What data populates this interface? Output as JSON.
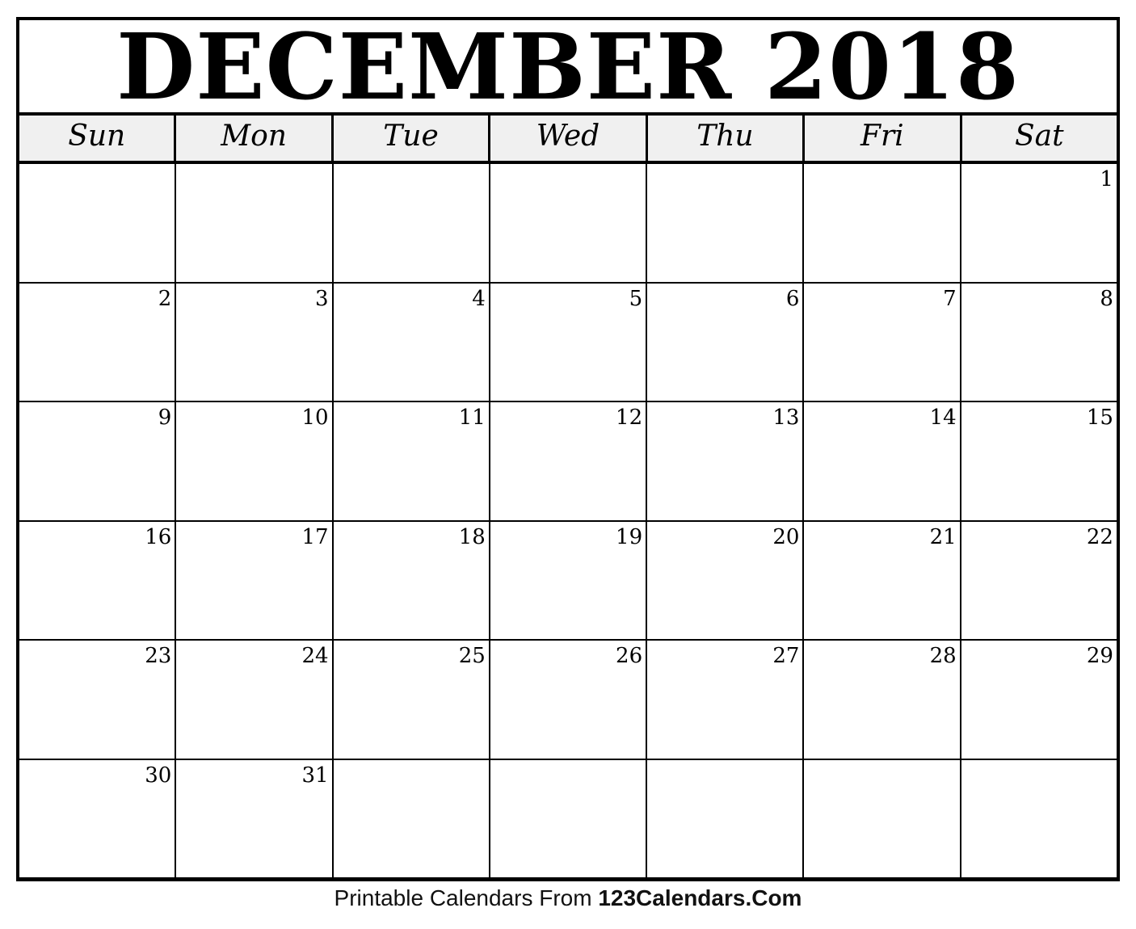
{
  "title": "DECEMBER 2018",
  "weekdays": [
    "Sun",
    "Mon",
    "Tue",
    "Wed",
    "Thu",
    "Fri",
    "Sat"
  ],
  "weeks": [
    [
      "",
      "",
      "",
      "",
      "",
      "",
      "1"
    ],
    [
      "2",
      "3",
      "4",
      "5",
      "6",
      "7",
      "8"
    ],
    [
      "9",
      "10",
      "11",
      "12",
      "13",
      "14",
      "15"
    ],
    [
      "16",
      "17",
      "18",
      "19",
      "20",
      "21",
      "22"
    ],
    [
      "23",
      "24",
      "25",
      "26",
      "27",
      "28",
      "29"
    ],
    [
      "30",
      "31",
      "",
      "",
      "",
      "",
      ""
    ]
  ],
  "footer": {
    "prefix": "Printable Calendars From ",
    "brand": "123Calendars.Com"
  }
}
